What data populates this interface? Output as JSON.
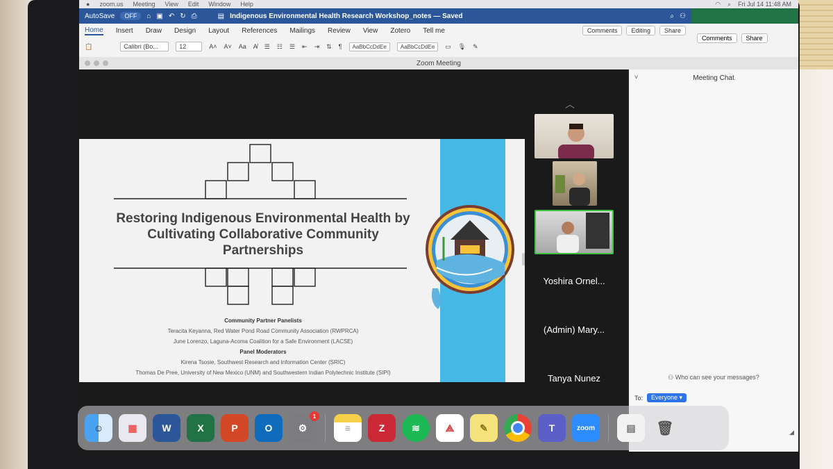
{
  "menubar": {
    "app": "zoom.us",
    "items": [
      "Meeting",
      "View",
      "Edit",
      "Window",
      "Help"
    ],
    "clock": "Fri Jul 14  11:48 AM"
  },
  "word": {
    "autosave": "AutoSave",
    "autosave_state": "OFF",
    "doc_title": "Indigenous Environmental Health Research Workshop_notes — Saved",
    "tabs": [
      "Home",
      "Insert",
      "Draw",
      "Design",
      "Layout",
      "References",
      "Mailings",
      "Review",
      "View",
      "Zotero",
      "Tell me"
    ],
    "comments_label": "Comments",
    "editing_label": "Editing",
    "share_label": "Share",
    "font_name": "Calibri (Bo...",
    "font_size": "12",
    "style1": "AaBbCcDdEe",
    "style2": "AaBbCcDdEe"
  },
  "excel": {
    "comments_label": "Comments",
    "share_label": "Share"
  },
  "zoom": {
    "window_title": "Zoom Meeting",
    "slide": {
      "title": "Restoring Indigenous Environmental Health by Cultivating Collaborative Community Partnerships",
      "panelists_heading": "Community Partner Panelists",
      "panelist1": "Teracita Keyanna, Red Water Pond Road Community Association (RWPRCA)",
      "panelist2": "June Lorenzo, Laguna-Acoma Coalition for a Safe Environment (LACSE)",
      "moderators_heading": "Panel Moderators",
      "moderator1": "Kirena Tsosie, Southwest Research and Information Center (SRIC)",
      "moderator2": "Thomas De Pree, University of New Mexico (UNM) and Southwestern Indian Polytechnic Institute (SIPI)"
    },
    "participants": [
      "Yoshira Ornel...",
      "(Admin) Mary...",
      "Tanya Nunez"
    ]
  },
  "chat": {
    "title": "Meeting Chat",
    "who_can_see": "Who can see your messages?",
    "to_label": "To:",
    "recipient": "Everyone"
  },
  "dock": {
    "word_letter": "W",
    "excel_letter": "X",
    "ppt_letter": "P",
    "outlook_letter": "O",
    "settings_badge": "1",
    "zotero_letter": "Z",
    "zoom_label": "zoom"
  },
  "colors": {
    "word_blue": "#2b579a",
    "excel_green": "#217346",
    "slide_blue": "#45b8e6",
    "speaker_outline": "#3ec43e"
  }
}
